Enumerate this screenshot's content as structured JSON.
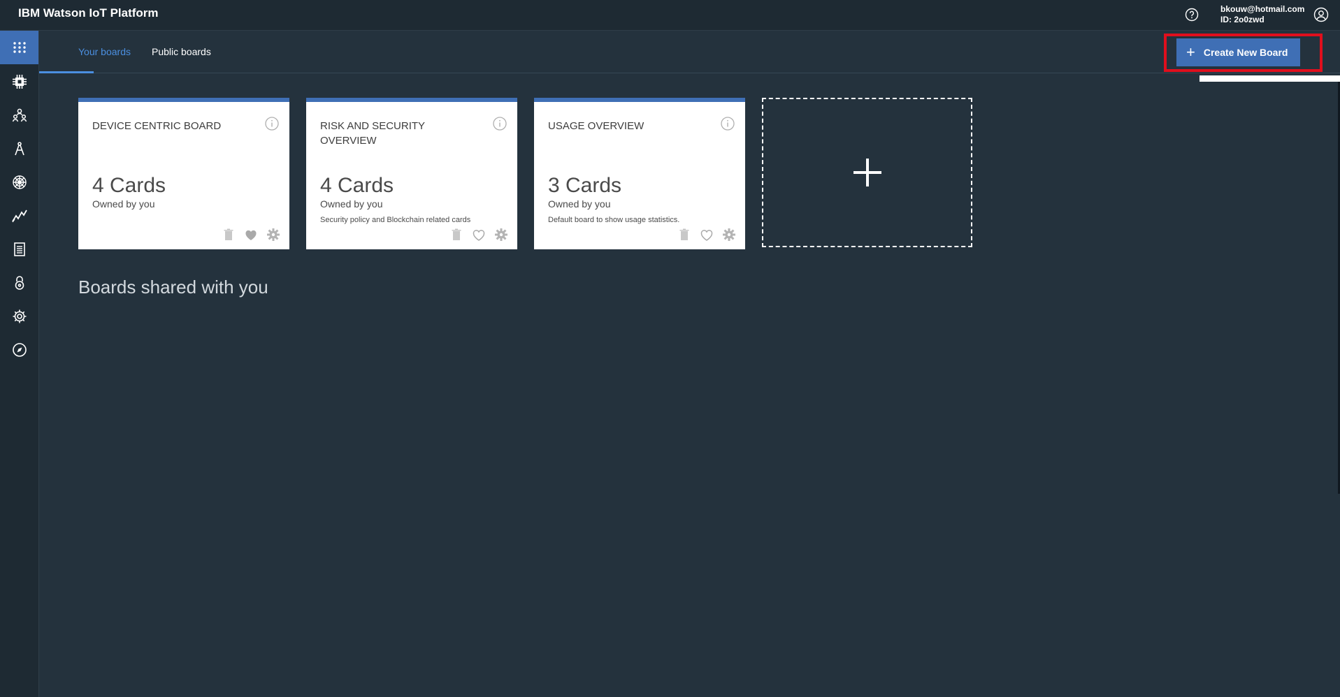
{
  "header": {
    "app_title": "IBM Watson IoT Platform",
    "user_email": "bkouw@hotmail.com",
    "user_id": "ID: 2o0zwd"
  },
  "sidebar": {
    "items": [
      {
        "icon": "boards-grid-icon",
        "active": true
      },
      {
        "icon": "devices-chip-icon"
      },
      {
        "icon": "members-icon"
      },
      {
        "icon": "apps-compass-icon"
      },
      {
        "icon": "extensions-icon"
      },
      {
        "icon": "analytics-icon"
      },
      {
        "icon": "logs-icon"
      },
      {
        "icon": "security-lock-icon"
      },
      {
        "icon": "settings-gear-icon"
      },
      {
        "icon": "explore-compass-icon"
      }
    ]
  },
  "tabs": [
    {
      "label": "Your boards",
      "active": true
    },
    {
      "label": "Public boards",
      "active": false
    }
  ],
  "create_button": {
    "label": "Create New Board"
  },
  "boards": [
    {
      "title": "DEVICE CENTRIC BOARD",
      "count": "4 Cards",
      "owner": "Owned by you",
      "description": "",
      "favorite": true
    },
    {
      "title": "RISK AND SECURITY OVERVIEW",
      "count": "4 Cards",
      "owner": "Owned by you",
      "description": "Security policy and Blockchain related cards",
      "favorite": false
    },
    {
      "title": "USAGE OVERVIEW",
      "count": "3 Cards",
      "owner": "Owned by you",
      "description": "Default board to show usage statistics.",
      "favorite": false
    }
  ],
  "shared_heading": "Boards shared with you",
  "colors": {
    "accent": "#3f6fb5",
    "highlight_frame": "#e00f1d",
    "background": "#24323d"
  }
}
